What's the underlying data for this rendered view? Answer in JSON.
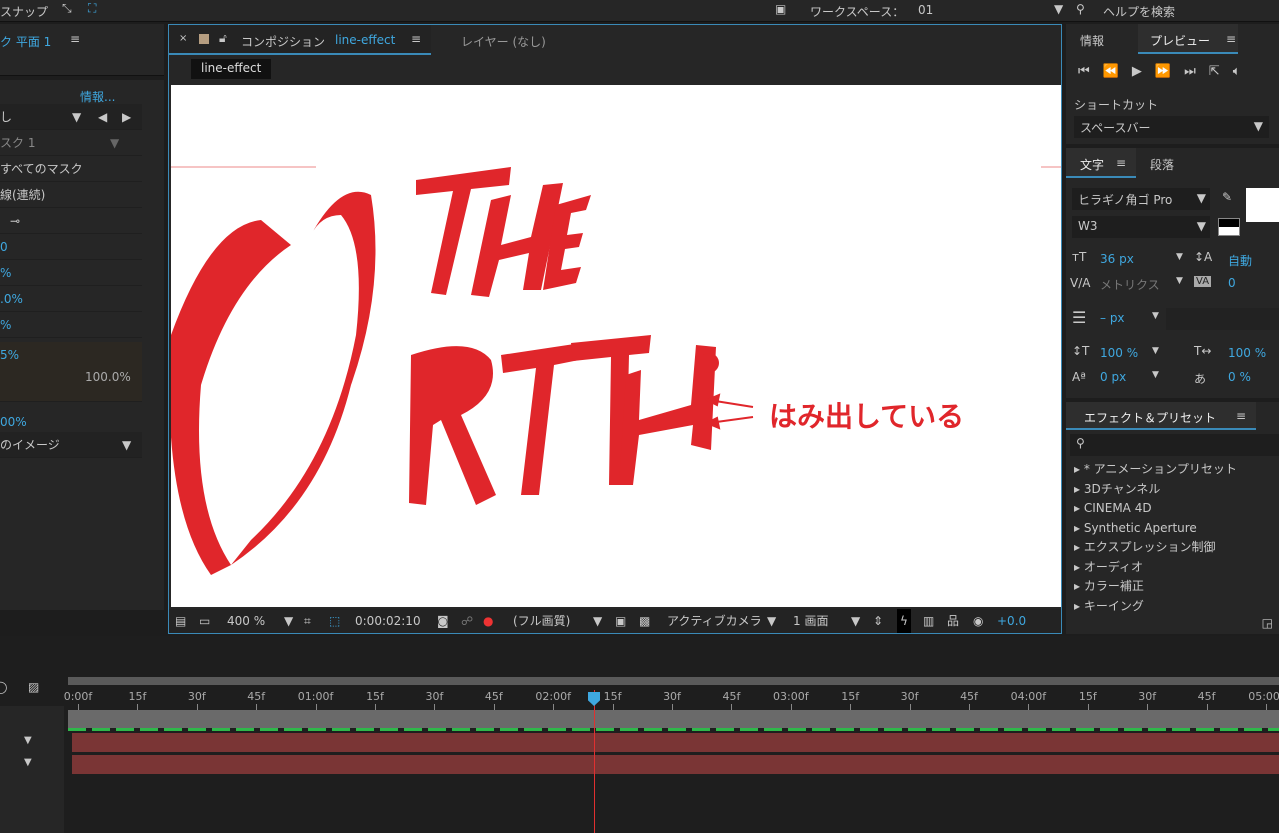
{
  "topbar": {
    "snap": "スナップ",
    "workspace_label": "ワークスペース：",
    "workspace_value": "01",
    "help_search": "ヘルプを検索"
  },
  "left": {
    "title": "ク 平面 1",
    "info": "情報...",
    "rows": [
      "し",
      "スク 1",
      "すべてのマスク",
      "線(連続)",
      "",
      "0",
      "%",
      ".0%",
      "%",
      "5%",
      "100.0%",
      "00%",
      "のイメージ"
    ]
  },
  "comp": {
    "tab_label": "コンポジション",
    "tab_name": "line-effect",
    "layer_tab": "レイヤー (なし)",
    "breadcrumb": "line-effect",
    "annotation": "はみ出している",
    "footer": {
      "zoom": "400 %",
      "timecode": "0:00:02:10",
      "quality": "(フル画質)",
      "camera": "アクティブカメラ",
      "views": "1 画面",
      "exposure": "+0.0"
    }
  },
  "right": {
    "tabs": [
      "情報",
      "プレビュー"
    ],
    "shortcut_label": "ショートカット",
    "shortcut_value": "スペースバー",
    "char_tabs": [
      "文字",
      "段落"
    ],
    "font": "ヒラギノ角ゴ Pro",
    "weight": "W3",
    "size": "36 px",
    "leading": "自動",
    "kerning": "メトリクス",
    "tracking": "0",
    "stroke": "– px",
    "vscale": "100 %",
    "hscale": "100 %",
    "baseline": "0 px",
    "tsume": "0 %",
    "effects_title": "エフェクト＆プリセット",
    "effects": [
      "▸ * アニメーションプリセット",
      "▸ 3Dチャンネル",
      "▸ CINEMA 4D",
      "▸ Synthetic Aperture",
      "▸ エクスプレッション制御",
      "▸ オーディオ",
      "▸ カラー補正",
      "▸ キーイング"
    ]
  },
  "timeline": {
    "ticks": [
      "0:00f",
      "15f",
      "30f",
      "45f",
      "01:00f",
      "15f",
      "30f",
      "45f",
      "02:00f",
      "15f",
      "30f",
      "45f",
      "03:00f",
      "15f",
      "30f",
      "45f",
      "04:00f",
      "15f",
      "30f",
      "45f",
      "05:00f"
    ]
  },
  "colors": {
    "accent": "#3fa8e0",
    "red": "#e0262b",
    "layer": "#7a3535",
    "keyline": "#2fb84a"
  }
}
